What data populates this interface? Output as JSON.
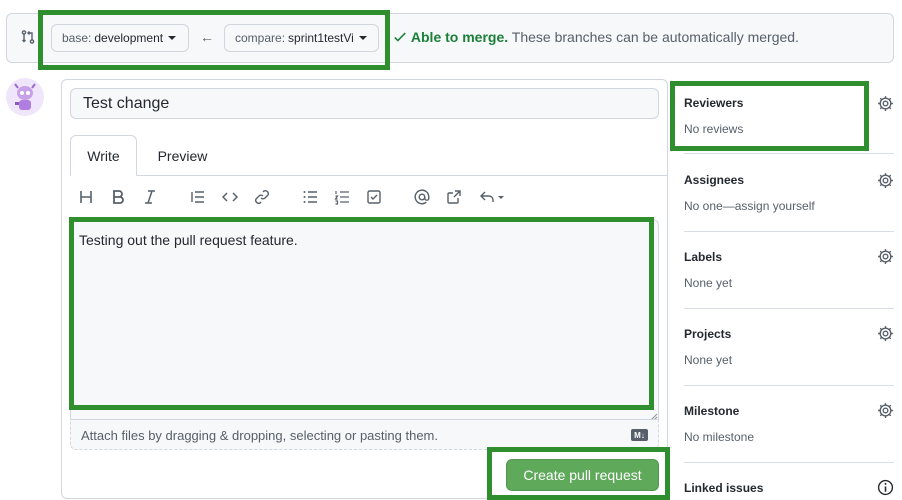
{
  "compare": {
    "base_prefix": "base:",
    "base_branch": "development",
    "arrow": "←",
    "compare_prefix": "compare:",
    "compare_branch": "sprint1testVi",
    "merge_ok": "Able to merge.",
    "merge_msg": "These branches can be automatically merged."
  },
  "form": {
    "title_value": "Test change",
    "tabs": [
      "Write",
      "Preview"
    ],
    "toolbar_icons": [
      "heading-icon",
      "bold-icon",
      "italic-icon",
      "quote-icon",
      "code-icon",
      "link-icon",
      "bullet-list-icon",
      "numbered-list-icon",
      "task-list-icon",
      "mention-icon",
      "reference-icon",
      "reply-icon"
    ],
    "body_text": "Testing out the pull request feature.",
    "attach_text": "Attach files by dragging & dropping, selecting or pasting them.",
    "markdown_badge": "M↓",
    "submit_label": "Create pull request"
  },
  "sidebar": {
    "sections": [
      {
        "heading": "Reviewers",
        "value": "No reviews",
        "icon": "gear-icon"
      },
      {
        "heading": "Assignees",
        "value": "No one—assign yourself",
        "icon": "gear-icon"
      },
      {
        "heading": "Labels",
        "value": "None yet",
        "icon": "gear-icon"
      },
      {
        "heading": "Projects",
        "value": "None yet",
        "icon": "gear-icon"
      },
      {
        "heading": "Milestone",
        "value": "No milestone",
        "icon": "gear-icon"
      },
      {
        "heading": "Linked issues",
        "value": "",
        "icon": "info-icon"
      }
    ]
  },
  "colors": {
    "accent_green": "#1a7f37",
    "button_green": "#5fa95b",
    "highlight_green": "#2f8f2f"
  }
}
